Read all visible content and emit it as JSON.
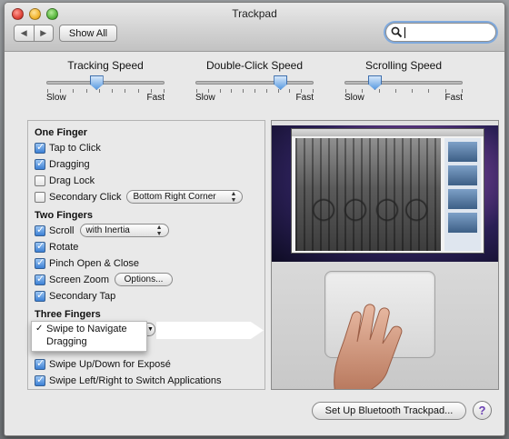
{
  "window": {
    "title": "Trackpad"
  },
  "toolbar": {
    "back_icon": "back-arrow-icon",
    "forward_icon": "forward-arrow-icon",
    "show_all_label": "Show All",
    "search_value": "",
    "search_icon": "magnifier-icon"
  },
  "sliders": [
    {
      "title": "Tracking Speed",
      "min_label": "Slow",
      "max_label": "Fast",
      "value": 0.42,
      "ticks": 10
    },
    {
      "title": "Double-Click Speed",
      "min_label": "Slow",
      "max_label": "Fast",
      "value": 0.72,
      "ticks": 11
    },
    {
      "title": "Scrolling Speed",
      "min_label": "Slow",
      "max_label": "Fast",
      "value": 0.25,
      "ticks": 8
    }
  ],
  "one_finger": {
    "title": "One Finger",
    "tap_to_click": {
      "label": "Tap to Click",
      "checked": true
    },
    "dragging": {
      "label": "Dragging",
      "checked": true
    },
    "drag_lock": {
      "label": "Drag Lock",
      "checked": false
    },
    "secondary_click": {
      "label": "Secondary Click",
      "checked": false,
      "option": "Bottom Right Corner"
    }
  },
  "two_fingers": {
    "title": "Two Fingers",
    "scroll": {
      "label": "Scroll",
      "checked": true,
      "option": "with Inertia"
    },
    "rotate": {
      "label": "Rotate",
      "checked": true
    },
    "pinch": {
      "label": "Pinch Open & Close",
      "checked": true
    },
    "screen_zoom": {
      "label": "Screen Zoom",
      "checked": true,
      "button": "Options..."
    },
    "secondary_tap": {
      "label": "Secondary Tap",
      "checked": true
    }
  },
  "three_fingers": {
    "title": "Three Fingers",
    "menu_options": [
      "Swipe to Navigate",
      "Dragging"
    ],
    "selected": "Swipe to Navigate",
    "checkmark": "✓"
  },
  "four_fingers": {
    "swipe_expose": {
      "label": "Swipe Up/Down for Exposé",
      "checked": true
    },
    "swipe_switch": {
      "label": "Swipe Left/Right to Switch Applications",
      "checked": true
    }
  },
  "footer": {
    "bluetooth_button": "Set Up Bluetooth Trackpad...",
    "help_label": "?"
  }
}
